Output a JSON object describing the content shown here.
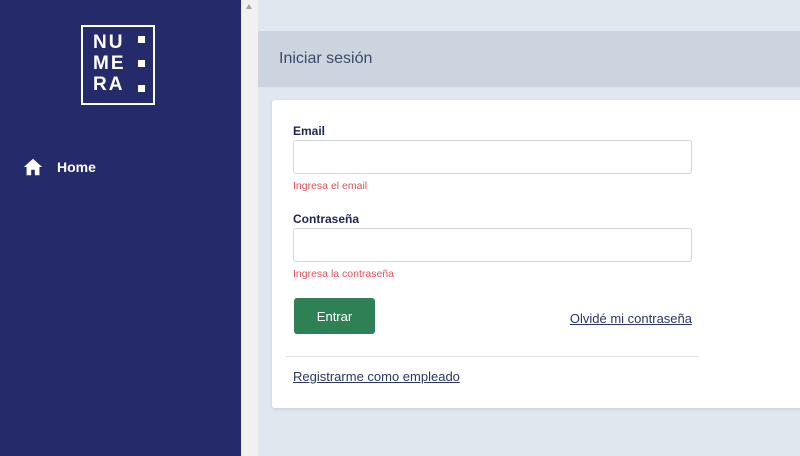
{
  "brand": {
    "logo_rows": [
      "NU",
      "ME",
      "RA"
    ]
  },
  "sidebar": {
    "items": [
      {
        "label": "Home",
        "icon": "home-icon"
      }
    ]
  },
  "header": {
    "title": "Iniciar sesión"
  },
  "login_form": {
    "email": {
      "label": "Email",
      "value": "",
      "placeholder": "",
      "error": "Ingresa el email"
    },
    "password": {
      "label": "Contraseña",
      "value": "",
      "placeholder": "",
      "error": "Ingresa la contraseña"
    },
    "submit_label": "Entrar",
    "forgot_password_label": "Olvidé mi contraseña",
    "register_label": "Registrarme como empleado"
  },
  "colors": {
    "sidebar_bg": "#252a6b",
    "primary_button": "#2e8055",
    "error": "#e4505a",
    "page_bg": "#e1e7ef",
    "header_bg": "#cbd4df"
  }
}
